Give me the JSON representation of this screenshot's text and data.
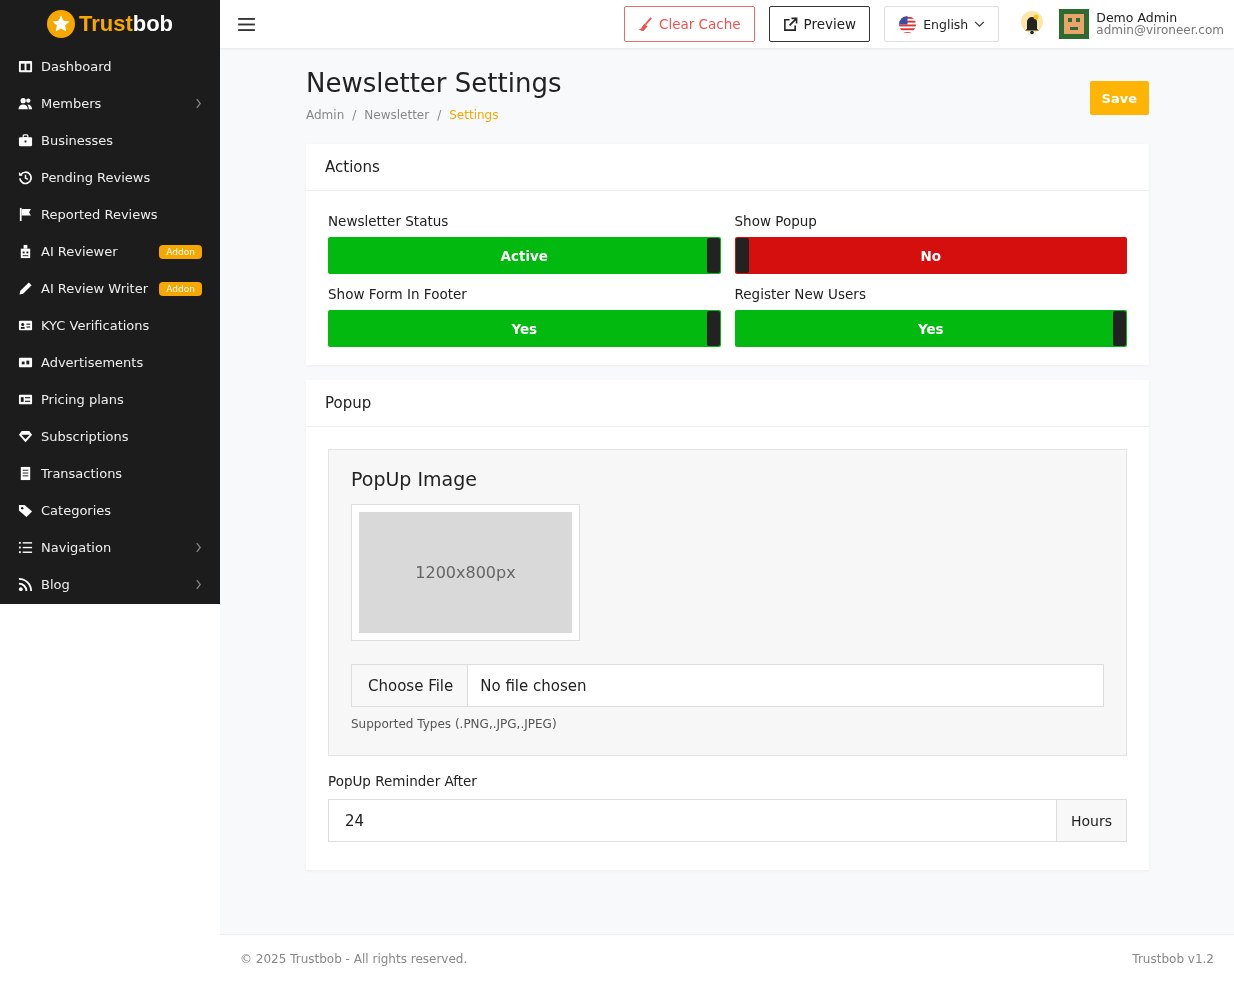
{
  "logo": {
    "first": "Trust",
    "second": "bob"
  },
  "sidebar": {
    "items": [
      {
        "label": "Dashboard",
        "expandable": false
      },
      {
        "label": "Members",
        "expandable": true
      },
      {
        "label": "Businesses",
        "expandable": false
      },
      {
        "label": "Pending Reviews",
        "expandable": false
      },
      {
        "label": "Reported Reviews",
        "expandable": false
      },
      {
        "label": "AI Reviewer",
        "expandable": false,
        "badge": "Addon"
      },
      {
        "label": "AI Review Writer",
        "expandable": false,
        "badge": "Addon"
      },
      {
        "label": "KYC Verifications",
        "expandable": false
      },
      {
        "label": "Advertisements",
        "expandable": false
      },
      {
        "label": "Pricing plans",
        "expandable": false
      },
      {
        "label": "Subscriptions",
        "expandable": false
      },
      {
        "label": "Transactions",
        "expandable": false
      },
      {
        "label": "Categories",
        "expandable": false
      },
      {
        "label": "Navigation",
        "expandable": true
      },
      {
        "label": "Blog",
        "expandable": true
      }
    ]
  },
  "topbar": {
    "clear_cache": "Clear Cache",
    "preview": "Preview",
    "language": "English",
    "user": {
      "name": "Demo Admin",
      "email": "admin@vironeer.com"
    }
  },
  "page": {
    "title": "Newsletter Settings",
    "breadcrumb_separator": "/",
    "breadcrumb": [
      {
        "label": "Admin",
        "selected": false
      },
      {
        "label": "Newsletter",
        "selected": false
      },
      {
        "label": "Settings",
        "selected": true
      }
    ],
    "save": "Save"
  },
  "actions": {
    "title": "Actions",
    "toggles": [
      {
        "label": "Newsletter Status",
        "on": true,
        "text": "Active"
      },
      {
        "label": "Show Popup",
        "on": false,
        "text": "No"
      },
      {
        "label": "Show Form In Footer",
        "on": true,
        "text": "Yes"
      },
      {
        "label": "Register New Users",
        "on": true,
        "text": "Yes"
      }
    ]
  },
  "popup": {
    "title": "Popup",
    "image_title": "PopUp Image",
    "image_placeholder": "1200x800px",
    "file_button": "Choose File",
    "file_status": "No file chosen",
    "supported": "Supported Types (.PNG,.JPG,.JPEG)",
    "reminder_label": "PopUp Reminder After",
    "reminder_value": "24",
    "reminder_unit": "Hours"
  },
  "footer": {
    "copyright": "© 2025 Trustbob - All rights reserved.",
    "version": "Trustbob v1.2"
  }
}
